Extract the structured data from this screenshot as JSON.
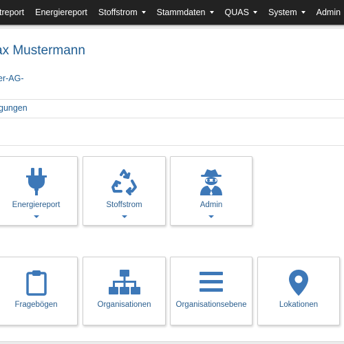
{
  "navbar": {
    "items": [
      {
        "label": "treport",
        "dropdown": false
      },
      {
        "label": "Energiereport",
        "dropdown": false
      },
      {
        "label": "Stoffstrom",
        "dropdown": true
      },
      {
        "label": "Stammdaten",
        "dropdown": true
      },
      {
        "label": "QUAS",
        "dropdown": true
      },
      {
        "label": "System",
        "dropdown": true
      },
      {
        "label": "Admin",
        "dropdown": true
      }
    ]
  },
  "profile": {
    "user_name": "ax Mustermann",
    "organization": "er-AG-",
    "tab_label": "gungen"
  },
  "tiles_row1": [
    {
      "label": "Energiereport",
      "icon": "plug-icon"
    },
    {
      "label": "Stoffstrom",
      "icon": "recycle-icon"
    },
    {
      "label": "Admin",
      "icon": "user-secret-icon"
    }
  ],
  "tiles_row2": [
    {
      "label": "Fragebögen",
      "icon": "clipboard-icon"
    },
    {
      "label": "Organisationen",
      "icon": "sitemap-icon"
    },
    {
      "label": "Organisationsebene",
      "icon": "bars-icon"
    },
    {
      "label": "Lokationen",
      "icon": "map-marker-icon"
    }
  ],
  "colors": {
    "navbar_bg": "#222222",
    "link_blue": "#1f5d92",
    "icon_blue": "#3d78b8"
  }
}
